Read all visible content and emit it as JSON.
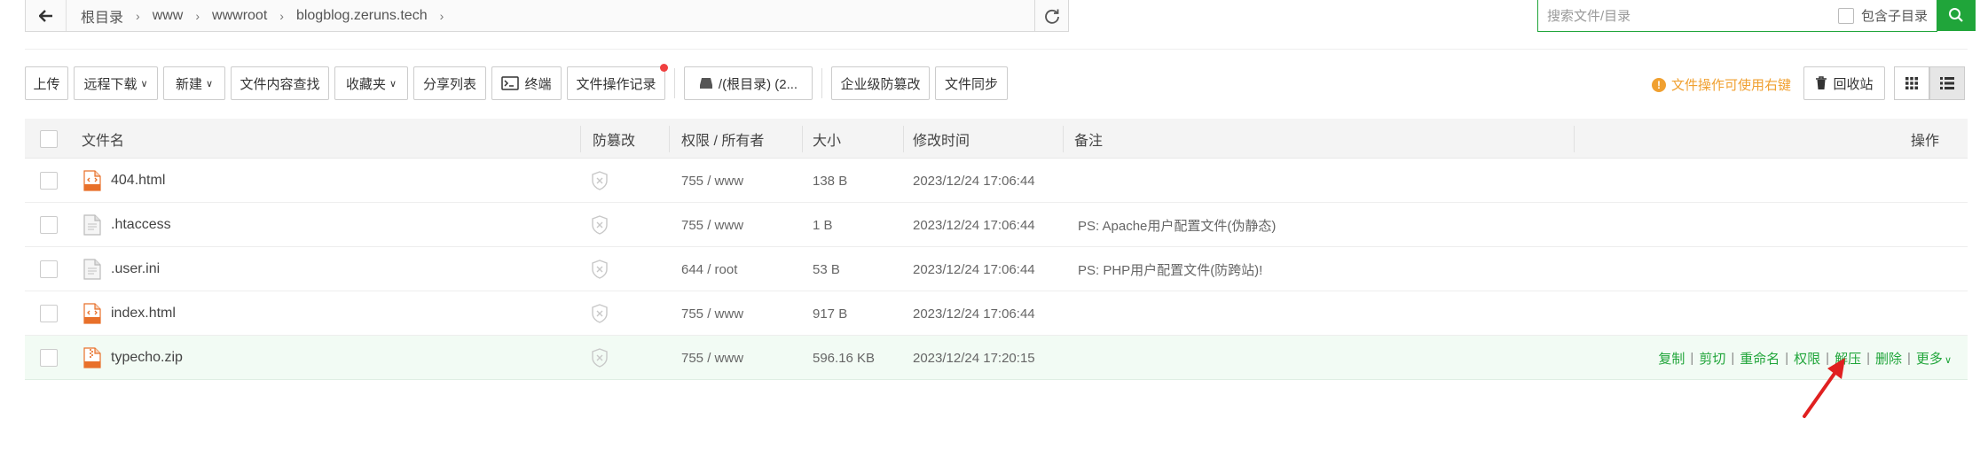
{
  "path": {
    "back_icon": "arrow-left-icon",
    "crumbs": [
      "根目录",
      "www",
      "wwwroot",
      "blogblog.zeruns.tech"
    ],
    "refresh_icon": "refresh-icon"
  },
  "search": {
    "placeholder": "搜索文件/目录",
    "include_sub_label": "包含子目录",
    "include_sub_checked": false,
    "button_icon": "search-icon"
  },
  "toolbar": {
    "upload": "上传",
    "remote_download": "远程下载",
    "new": "新建",
    "content_search": "文件内容查找",
    "favorites": "收藏夹",
    "share_list": "分享列表",
    "terminal": "终端",
    "op_log": "文件操作记录",
    "disk": "/(根目录) (2...",
    "tamper": "企业级防篡改",
    "sync": "文件同步"
  },
  "tip": "文件操作可使用右键",
  "recycle": "回收站",
  "columns": {
    "name": "文件名",
    "tamper": "防篡改",
    "perm": "权限 / 所有者",
    "size": "大小",
    "mtime": "修改时间",
    "note": "备注",
    "ops": "操作"
  },
  "files": [
    {
      "name": "404.html",
      "icon": "html-file-icon",
      "perm": "755 / www",
      "size": "138 B",
      "mtime": "2023/12/24 17:06:44",
      "note": ""
    },
    {
      "name": ".htaccess",
      "icon": "text-file-icon",
      "perm": "755 / www",
      "size": "1 B",
      "mtime": "2023/12/24 17:06:44",
      "note": "PS: Apache用户配置文件(伪静态)"
    },
    {
      "name": ".user.ini",
      "icon": "text-file-icon",
      "perm": "644 / root",
      "size": "53 B",
      "mtime": "2023/12/24 17:06:44",
      "note": "PS: PHP用户配置文件(防跨站)!"
    },
    {
      "name": "index.html",
      "icon": "html-file-icon",
      "perm": "755 / www",
      "size": "917 B",
      "mtime": "2023/12/24 17:06:44",
      "note": ""
    },
    {
      "name": "typecho.zip",
      "icon": "zip-file-icon",
      "perm": "755 / www",
      "size": "596.16 KB",
      "mtime": "2023/12/24 17:20:15",
      "note": ""
    }
  ],
  "row_ops": [
    "复制",
    "剪切",
    "重命名",
    "权限",
    "解压",
    "删除",
    "更多"
  ],
  "colors": {
    "accent": "#20a53a",
    "warning": "#f0a030",
    "annotation": "#e02020"
  }
}
